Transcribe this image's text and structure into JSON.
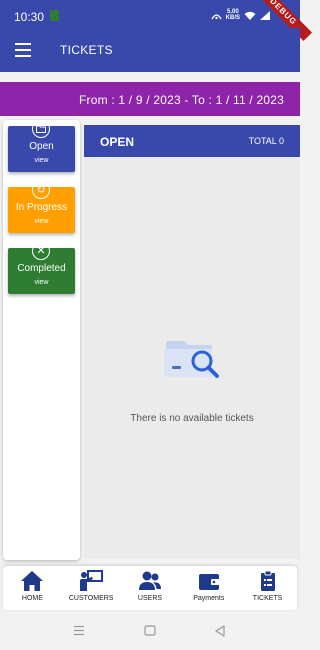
{
  "status_bar": {
    "time": "10:30",
    "speed_value": "5.00",
    "speed_unit": "KB/S",
    "debug_label": "DEBUG"
  },
  "app_bar": {
    "title": "TICKETS",
    "menu_icon": "hamburger-menu-icon",
    "color": "#3949ab"
  },
  "date_range": {
    "text": "From : 1 / 9 / 2023  - To : 1 / 11 / 2023",
    "color": "#8e24aa"
  },
  "status_filters": [
    {
      "label": "Open",
      "sub": "view",
      "icon": "folder-icon",
      "color": "#3949ab"
    },
    {
      "label": "In Progress",
      "sub": "view",
      "icon": "refresh-icon",
      "color": "#ffa000"
    },
    {
      "label": "Completed",
      "sub": "view",
      "icon": "close-circle-icon",
      "color": "#2e7d32"
    }
  ],
  "main_panel": {
    "status_title": "OPEN",
    "total_label": "TOTAL 0",
    "empty_message": "There is no available tickets",
    "empty_icon": "folder-search-icon"
  },
  "bottom_nav": [
    {
      "label": "HOME",
      "icon": "home-icon"
    },
    {
      "label": "CUSTOMERS",
      "icon": "customer-presentation-icon"
    },
    {
      "label": "USERS",
      "icon": "users-icon"
    },
    {
      "label": "Payments",
      "icon": "wallet-icon"
    },
    {
      "label": "TICKETS",
      "icon": "clipboard-icon"
    }
  ],
  "accent_color": "#1e3a8a"
}
